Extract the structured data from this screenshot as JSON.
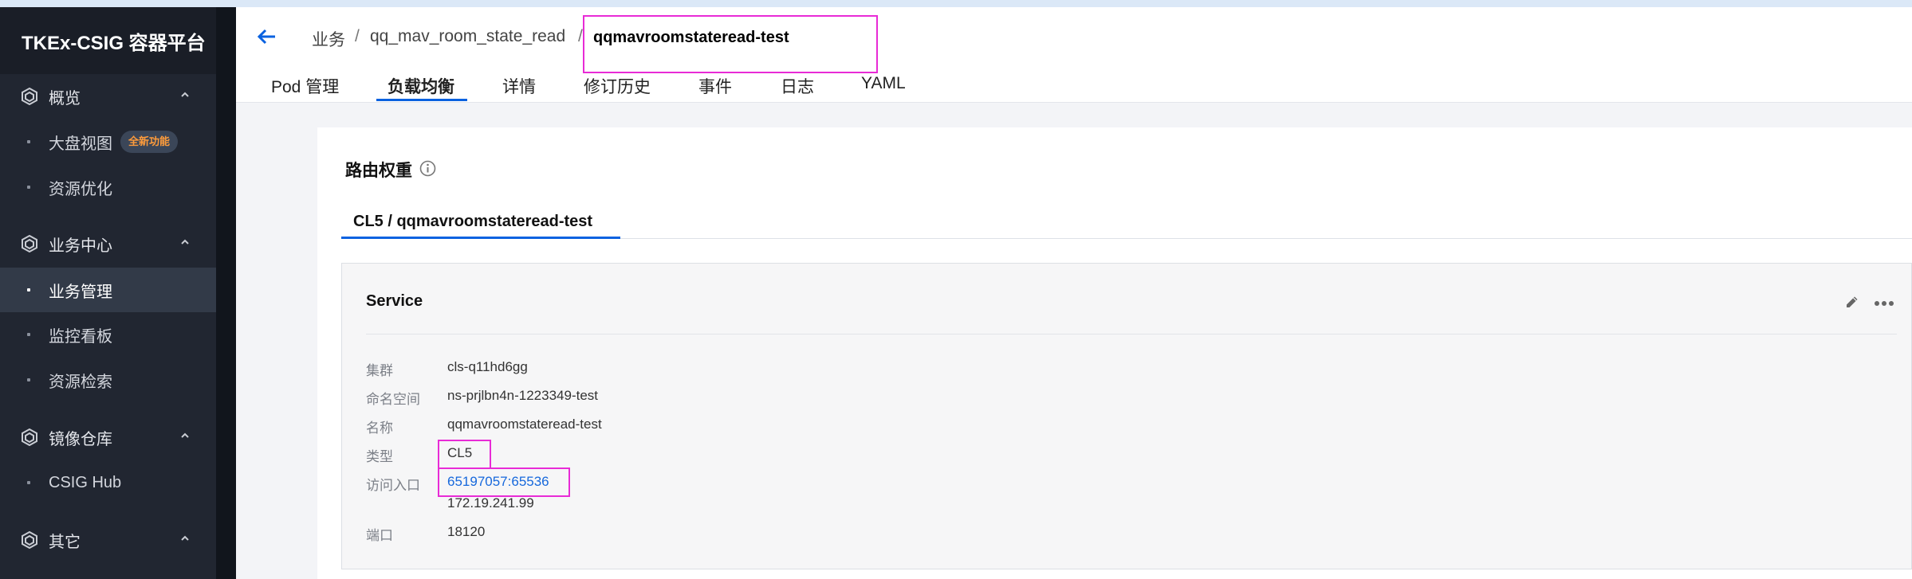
{
  "sidebar": {
    "brand": "TKEx-CSIG 容器平台",
    "groups": [
      {
        "label": "概览",
        "items": [
          {
            "label": "大盘视图",
            "badge": "全新功能"
          },
          {
            "label": "资源优化"
          }
        ]
      },
      {
        "label": "业务中心",
        "items": [
          {
            "label": "业务管理",
            "active": true
          },
          {
            "label": "监控看板"
          },
          {
            "label": "资源检索"
          }
        ]
      },
      {
        "label": "镜像仓库",
        "items": [
          {
            "label": "CSIG Hub"
          }
        ]
      },
      {
        "label": "其它",
        "items": []
      }
    ]
  },
  "header": {
    "back_icon": "arrow-left-icon",
    "breadcrumb": [
      "业务",
      "qq_mav_room_state_read",
      "qqmavroomstateread-test"
    ],
    "separator": "/",
    "tabs": [
      "Pod 管理",
      "负载均衡",
      "详情",
      "修订历史",
      "事件",
      "日志",
      "YAML"
    ],
    "active_tab": "负载均衡"
  },
  "main": {
    "section_title": "路由权重",
    "subtab": "CL5 / qqmavroomstateread-test",
    "service": {
      "title": "Service",
      "fields": [
        {
          "label": "集群",
          "value": "cls-q11hd6gg"
        },
        {
          "label": "命名空间",
          "value": "ns-prjlbn4n-1223349-test"
        },
        {
          "label": "名称",
          "value": "qqmavroomstateread-test"
        },
        {
          "label": "类型",
          "value": "CL5"
        },
        {
          "label": "访问入口",
          "value": "65197057:65536",
          "value2": "172.19.241.99"
        },
        {
          "label": "端口",
          "value": "18120"
        }
      ]
    }
  },
  "colors": {
    "accent": "#0a62e0",
    "highlight": "#e82bd6",
    "sidebar_bg": "#212631",
    "link": "#1668dc",
    "badge_text": "#ff9c3b"
  }
}
